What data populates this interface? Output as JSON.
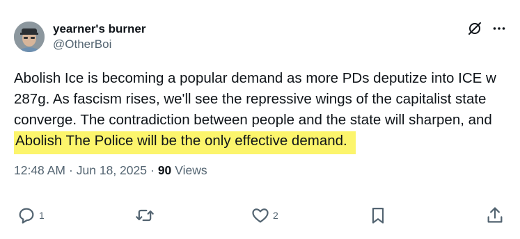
{
  "author": {
    "display_name": "yearner's burner",
    "handle": "@OtherBoi"
  },
  "tweet": {
    "text_before": "Abolish Ice is becoming a popular demand as more PDs deputize into ICE w 287g. As fascism rises, we'll see the repressive wings of the capitalist state converge. The contradiction between people and the state will sharpen, and ",
    "text_highlighted": "Abolish The Police will be the only effective demand."
  },
  "meta": {
    "time": "12:48 AM",
    "date": "Jun 18, 2025",
    "separator": "·",
    "views_count": "90",
    "views_label": "Views"
  },
  "actions": {
    "reply_count": "1",
    "repost_count": "",
    "like_count": "2"
  },
  "icons": {
    "top": [
      "grok-icon",
      "more-icon"
    ],
    "bottom": [
      "reply-icon",
      "repost-icon",
      "like-icon",
      "bookmark-icon",
      "share-icon"
    ]
  },
  "colors": {
    "text": "#0f1419",
    "secondary": "#536471",
    "highlight": "#fcf56c"
  }
}
